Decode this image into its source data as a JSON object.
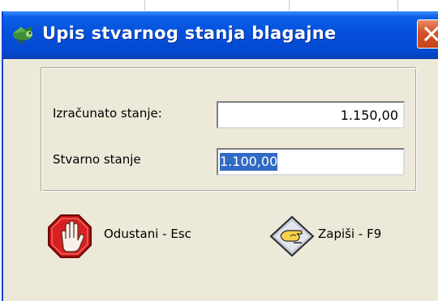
{
  "window": {
    "title": "Upis stvarnog stanja blagajne",
    "close_icon": "close-x-icon",
    "app_icon": "app-bird-icon"
  },
  "form": {
    "calculated_label": "Izračunato stanje:",
    "calculated_value": "1.150,00",
    "actual_label": "Stvarno stanje",
    "actual_value": "1.100,00"
  },
  "actions": {
    "cancel_label": "Odustani - Esc",
    "cancel_icon": "stop-hand-icon",
    "save_label": "Zapiši - F9",
    "save_icon": "hand-write-icon"
  },
  "colors": {
    "titlebar": "#0550dc",
    "close_button": "#d8562d",
    "selection": "#316ac5",
    "window_bg": "#ece9d8"
  }
}
